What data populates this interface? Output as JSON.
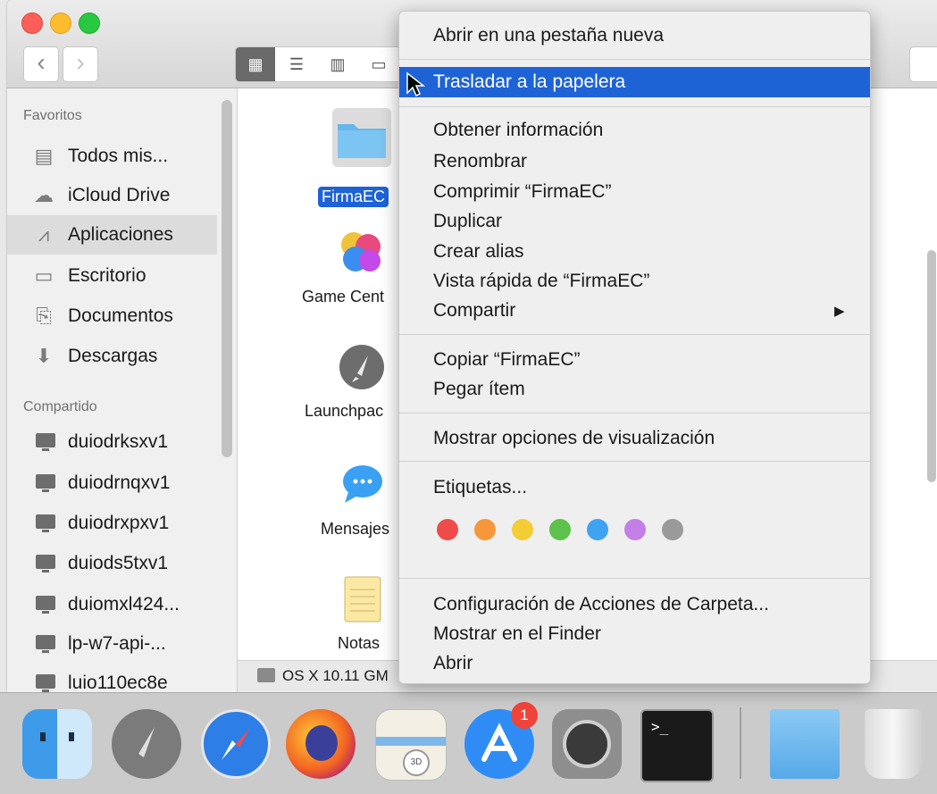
{
  "sidebar": {
    "favorites_header": "Favoritos",
    "favorites": [
      {
        "label": "Todos mis...",
        "icon": "all-files-icon"
      },
      {
        "label": "iCloud Drive",
        "icon": "cloud-icon"
      },
      {
        "label": "Aplicaciones",
        "icon": "applications-icon",
        "selected": true
      },
      {
        "label": "Escritorio",
        "icon": "desktop-icon"
      },
      {
        "label": "Documentos",
        "icon": "document-icon"
      },
      {
        "label": "Descargas",
        "icon": "download-icon"
      }
    ],
    "shared_header": "Compartido",
    "shared": [
      {
        "label": "duiodrksxv1"
      },
      {
        "label": "duiodrnqxv1"
      },
      {
        "label": "duiodrxpxv1"
      },
      {
        "label": "duiods5txv1"
      },
      {
        "label": "duiomxl424..."
      },
      {
        "label": "lp-w7-api-..."
      },
      {
        "label": "luio110ec8e"
      }
    ]
  },
  "main": {
    "items": [
      {
        "label": "FirmaEC",
        "icon": "folder-icon",
        "selected": true
      },
      {
        "label": "Game Cent",
        "icon": "game-center-icon"
      },
      {
        "label": "Launchpac",
        "icon": "launchpad-icon"
      },
      {
        "label": "Mensajes",
        "icon": "messages-icon"
      },
      {
        "label": "Notas",
        "icon": "notes-icon"
      }
    ],
    "statusbar_text": "OS X 10.11 GM"
  },
  "context_menu": {
    "items": [
      {
        "label": "Abrir en una pestaña nueva"
      },
      {
        "label": "Trasladar a la papelera",
        "highlighted": true
      },
      {
        "label": "Obtener información"
      },
      {
        "label": "Renombrar"
      },
      {
        "label": "Comprimir “FirmaEC”"
      },
      {
        "label": "Duplicar"
      },
      {
        "label": "Crear alias"
      },
      {
        "label": "Vista rápida de “FirmaEC”"
      },
      {
        "label": "Compartir",
        "submenu": true
      },
      {
        "label": "Copiar “FirmaEC”"
      },
      {
        "label": "Pegar ítem"
      },
      {
        "label": "Mostrar opciones de visualización"
      },
      {
        "label": "Etiquetas..."
      },
      {
        "label": "Configuración de Acciones de Carpeta..."
      },
      {
        "label": "Mostrar en el Finder"
      },
      {
        "label": "Abrir"
      }
    ],
    "submenu_arrow": "▶",
    "tag_colors": [
      "#f04b4b",
      "#f5973a",
      "#f4cd36",
      "#5cc24b",
      "#3fa3f3",
      "#c37ee8",
      "#9a9a9a"
    ]
  },
  "dock": {
    "apps": [
      "finder-icon",
      "launchpad-icon",
      "safari-icon",
      "firefox-icon",
      "maps-icon",
      "app-store-icon",
      "system-preferences-icon",
      "terminal-icon",
      "folder-icon",
      "trash-icon"
    ],
    "app_store_badge": "1"
  },
  "colors": {
    "highlight": "#1e63d6",
    "folder": "#67b6ec"
  }
}
